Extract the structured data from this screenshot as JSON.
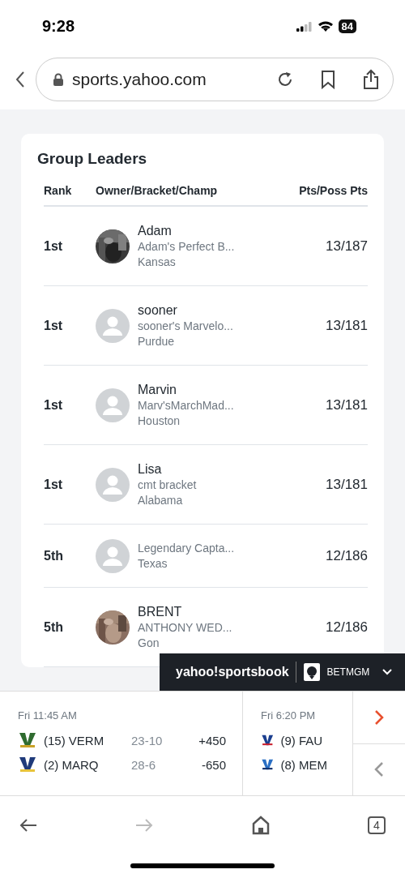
{
  "status_bar": {
    "time": "9:28",
    "battery": "84"
  },
  "browser": {
    "url": "sports.yahoo.com"
  },
  "card": {
    "title": "Group Leaders",
    "columns": [
      "Rank",
      "Owner/Bracket/Champ",
      "Pts/Poss Pts"
    ],
    "rows": [
      {
        "rank": "1st",
        "owner": "Adam",
        "bracket": "Adam's Perfect B...",
        "champ": "Kansas",
        "points": "13/187"
      },
      {
        "rank": "1st",
        "avatar": {
          "kind": "placeholder"
        },
        "owner": "sooner",
        "bracket": "sooner's Marvelo...",
        "champ": "Purdue",
        "points": "13/181"
      },
      {
        "rank": "1st",
        "avatar": {
          "kind": "placeholder"
        },
        "owner": "Marvin",
        "bracket": "Marv'sMarchMad...",
        "champ": "Houston",
        "points": "13/181"
      },
      {
        "rank": "1st",
        "avatar": {
          "kind": "placeholder"
        },
        "owner": "Lisa",
        "bracket": "cmt bracket",
        "champ": "Alabama",
        "points": "13/181"
      },
      {
        "rank": "5th",
        "avatar": {
          "kind": "placeholder"
        },
        "bracket": "Legendary Capta...",
        "champ": "Texas",
        "points": "12/186"
      },
      {
        "rank": "5th",
        "owner": "BRENT",
        "bracket": "ANTHONY WED...",
        "champ": "Gon",
        "points": "12/186"
      }
    ]
  },
  "sportsbook_banner": {
    "brand": "yahoo!sportsbook",
    "partner": "BETMGM"
  },
  "games": [
    {
      "time": "Fri 11:45 AM",
      "teams": [
        {
          "name": "(15) VERM",
          "record": "23-10",
          "odds": "+450"
        },
        {
          "name": "(2) MARQ",
          "record": "28-6",
          "odds": "-650"
        }
      ]
    },
    {
      "time": "Fri 6:20 PM",
      "teams": [
        {
          "name": "(9) FAU"
        },
        {
          "name": "(8) MEM"
        }
      ]
    }
  ],
  "toolbar": {
    "tabs_count": "4"
  }
}
